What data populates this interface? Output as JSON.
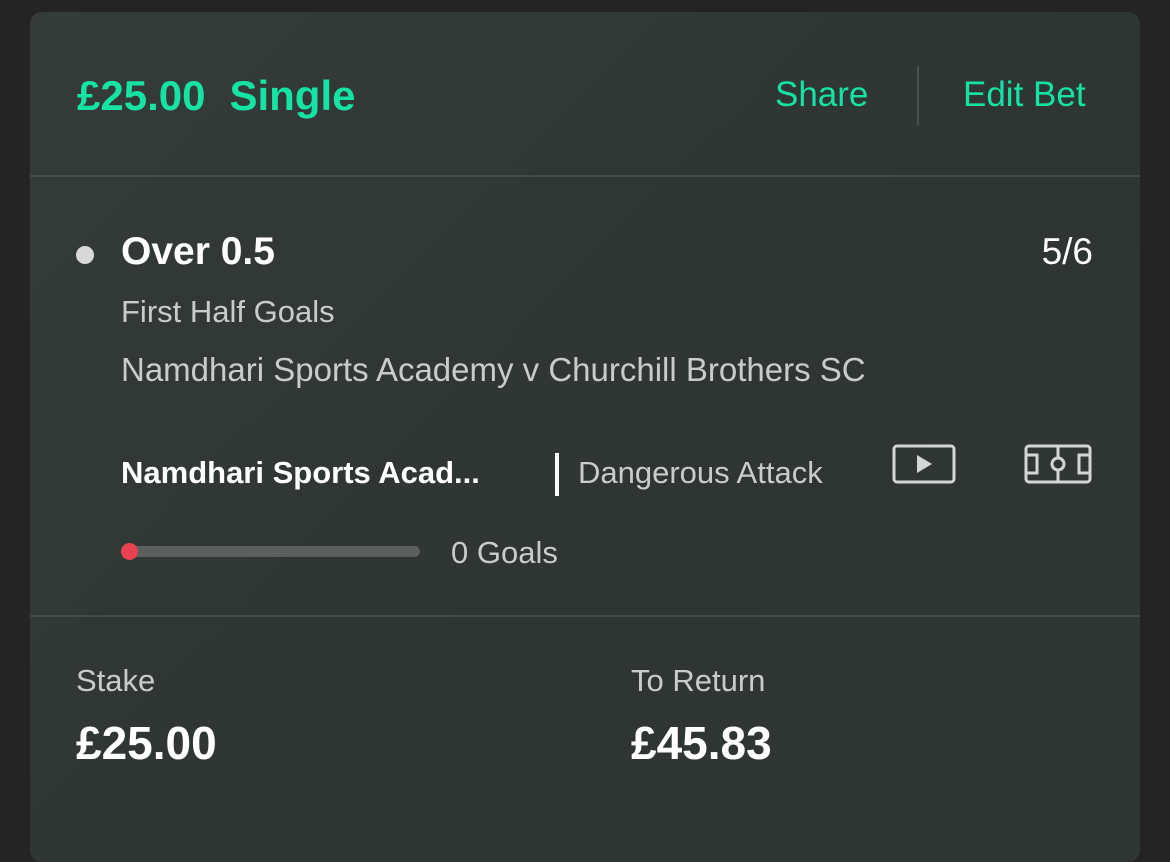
{
  "header": {
    "stake_amount": "£25.00",
    "bet_type": "Single",
    "share_label": "Share",
    "edit_label": "Edit Bet"
  },
  "selection": {
    "name": "Over 0.5",
    "odds": "5/6",
    "market": "First Half Goals",
    "event": "Namdhari Sports Academy v Churchill Brothers SC",
    "live": {
      "team": "Namdhari Sports Acad...",
      "status": "Dangerous Attack",
      "video_icon": "play-video-icon",
      "pitch_icon": "pitch-tracker-icon"
    },
    "progress": {
      "goals_text": "0 Goals",
      "fraction": 0
    }
  },
  "footer": {
    "stake_label": "Stake",
    "stake_value": "£25.00",
    "return_label": "To Return",
    "return_value": "£45.83"
  },
  "colors": {
    "accent": "#14e3a4",
    "progress_marker": "#e8414f",
    "card_bg": "#323836"
  }
}
